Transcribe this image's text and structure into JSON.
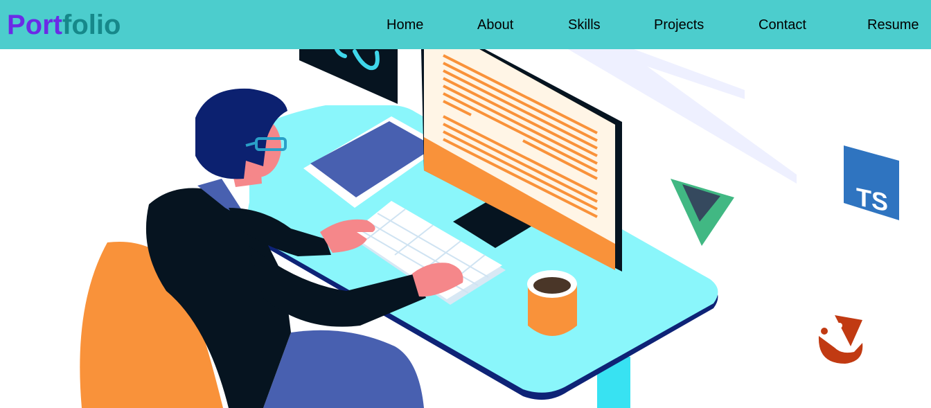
{
  "brand": {
    "part1": "Port",
    "part2": "folio",
    "color1": "#6b2be6",
    "color2": "#16888a"
  },
  "nav": {
    "bg": "#4ccdcd",
    "links": [
      {
        "label": "Home"
      },
      {
        "label": "About"
      },
      {
        "label": "Skills"
      },
      {
        "label": "Projects"
      },
      {
        "label": "Contact"
      },
      {
        "label": "Resume"
      }
    ]
  },
  "hero": {
    "illustration": "developer-at-desk",
    "badges": [
      {
        "icon": "vue-logo-icon"
      },
      {
        "icon": "typescript-logo-icon",
        "text": "TS"
      },
      {
        "icon": "jasmine-logo-icon"
      }
    ]
  }
}
